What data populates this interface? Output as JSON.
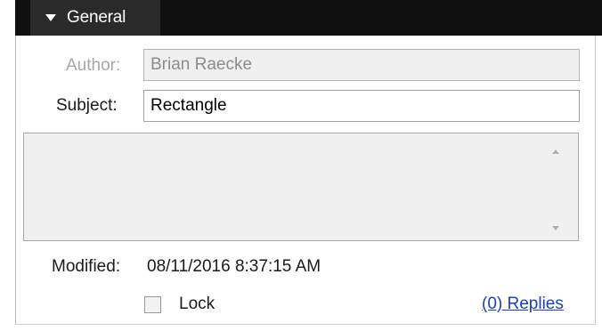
{
  "section": {
    "title": "General"
  },
  "fields": {
    "author": {
      "label": "Author:",
      "value": "Brian Raecke"
    },
    "subject": {
      "label": "Subject:",
      "value": "Rectangle"
    },
    "comment": {
      "value": ""
    }
  },
  "footer": {
    "modified_label": "Modified:",
    "modified_value": "08/11/2016 8:37:15 AM",
    "lock_label": "Lock",
    "lock_checked": false,
    "replies_link": "(0) Replies"
  },
  "icons": {
    "header": "expand-triangle-icon",
    "scroll_up": "scroll-up-arrow-icon",
    "scroll_down": "scroll-down-arrow-icon"
  }
}
